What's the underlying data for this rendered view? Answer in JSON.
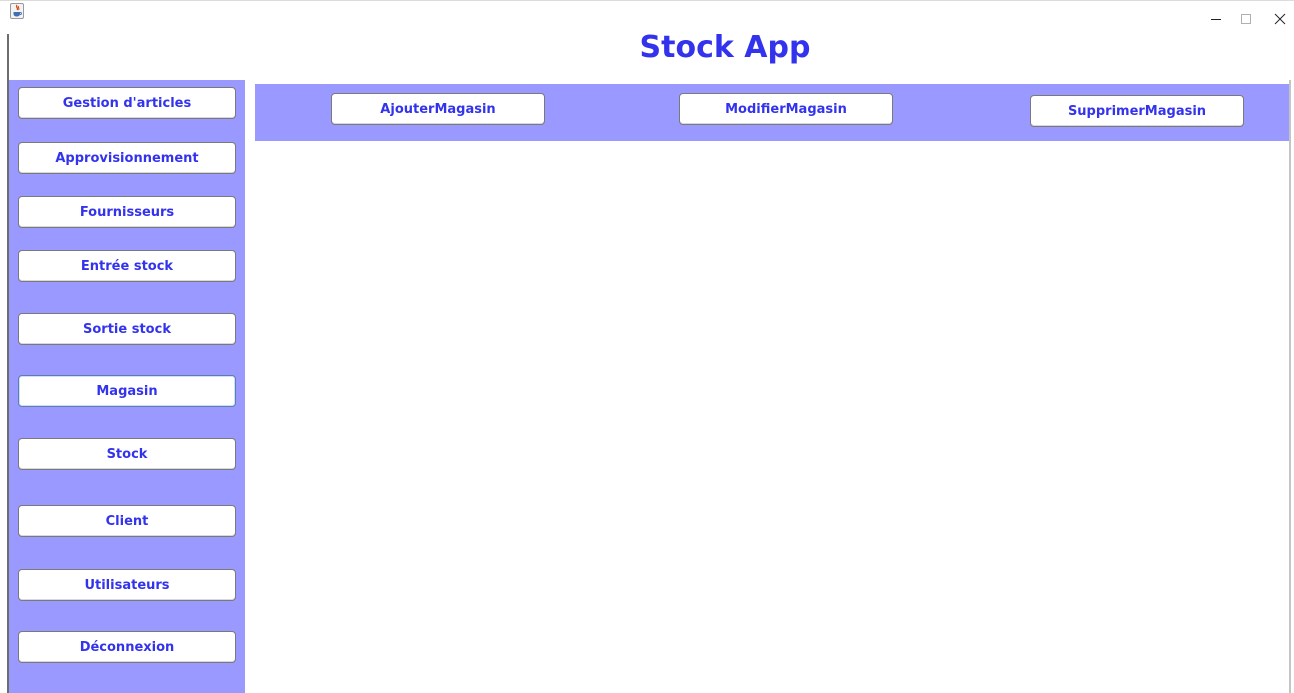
{
  "window": {
    "title": "",
    "controls": {
      "minimize_icon": "minimize-icon",
      "maximize_icon": "maximize-icon",
      "close_icon": "close-icon"
    }
  },
  "header": {
    "title": "Stock App",
    "color": "#3333ee"
  },
  "sidebar": {
    "background": "#9999ff",
    "items": [
      {
        "label": "Gestion d'articles"
      },
      {
        "label": "Approvisionnement"
      },
      {
        "label": "Fournisseurs"
      },
      {
        "label": "Entrée stock"
      },
      {
        "label": "Sortie stock"
      },
      {
        "label": "Magasin",
        "selected": true
      },
      {
        "label": "Stock"
      },
      {
        "label": "Client"
      },
      {
        "label": "Utilisateurs"
      },
      {
        "label": "Déconnexion"
      }
    ]
  },
  "toolbar": {
    "background": "#9999ff",
    "buttons": [
      {
        "label": "AjouterMagasin"
      },
      {
        "label": "ModifierMagasin"
      },
      {
        "label": "SupprimerMagasin"
      }
    ]
  }
}
